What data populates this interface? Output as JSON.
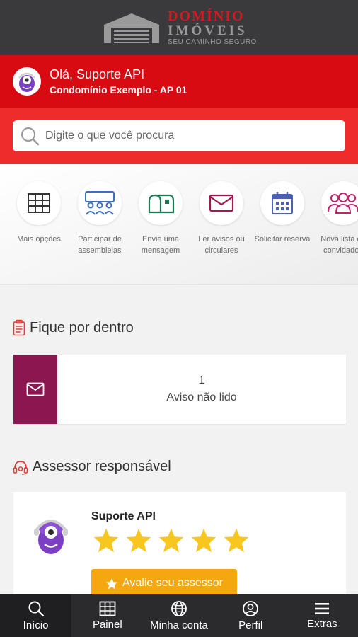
{
  "brand": {
    "line1": "DOMÍNIO",
    "line2": "IMÓVEIS",
    "line3": "SEU CAMINHO SEGURO",
    "primary_color": "#d90b12",
    "dark_color": "#3a3a3c"
  },
  "user": {
    "greeting": "Olá, Suporte API",
    "condo": "Condomínio Exemplo - AP 01"
  },
  "search": {
    "placeholder": "Digite o que você procura"
  },
  "shortcuts": [
    {
      "label": "Mais opções",
      "icon": "grid-icon"
    },
    {
      "label": "Participar de assembleias",
      "icon": "people-group-icon"
    },
    {
      "label": "Envie uma mensagem",
      "icon": "mailbox-icon"
    },
    {
      "label": "Ler avisos ou circulares",
      "icon": "envelope-icon"
    },
    {
      "label": "Solicitar reserva",
      "icon": "calendar-icon"
    },
    {
      "label": "Nova lista de convidados",
      "icon": "guests-icon"
    }
  ],
  "stay_informed": {
    "title": "Fique por dentro",
    "notice_count": "1",
    "notice_label": "Aviso não lido"
  },
  "advisor": {
    "title": "Assessor responsável",
    "name": "Suporte API",
    "rating": 5,
    "rate_button": "Avalie seu assessor"
  },
  "bottom_nav": [
    {
      "label": "Início",
      "icon": "search-icon"
    },
    {
      "label": "Painel",
      "icon": "grid-icon"
    },
    {
      "label": "Minha conta",
      "icon": "globe-icon"
    },
    {
      "label": "Perfil",
      "icon": "user-icon"
    },
    {
      "label": "Extras",
      "icon": "menu-icon"
    }
  ]
}
